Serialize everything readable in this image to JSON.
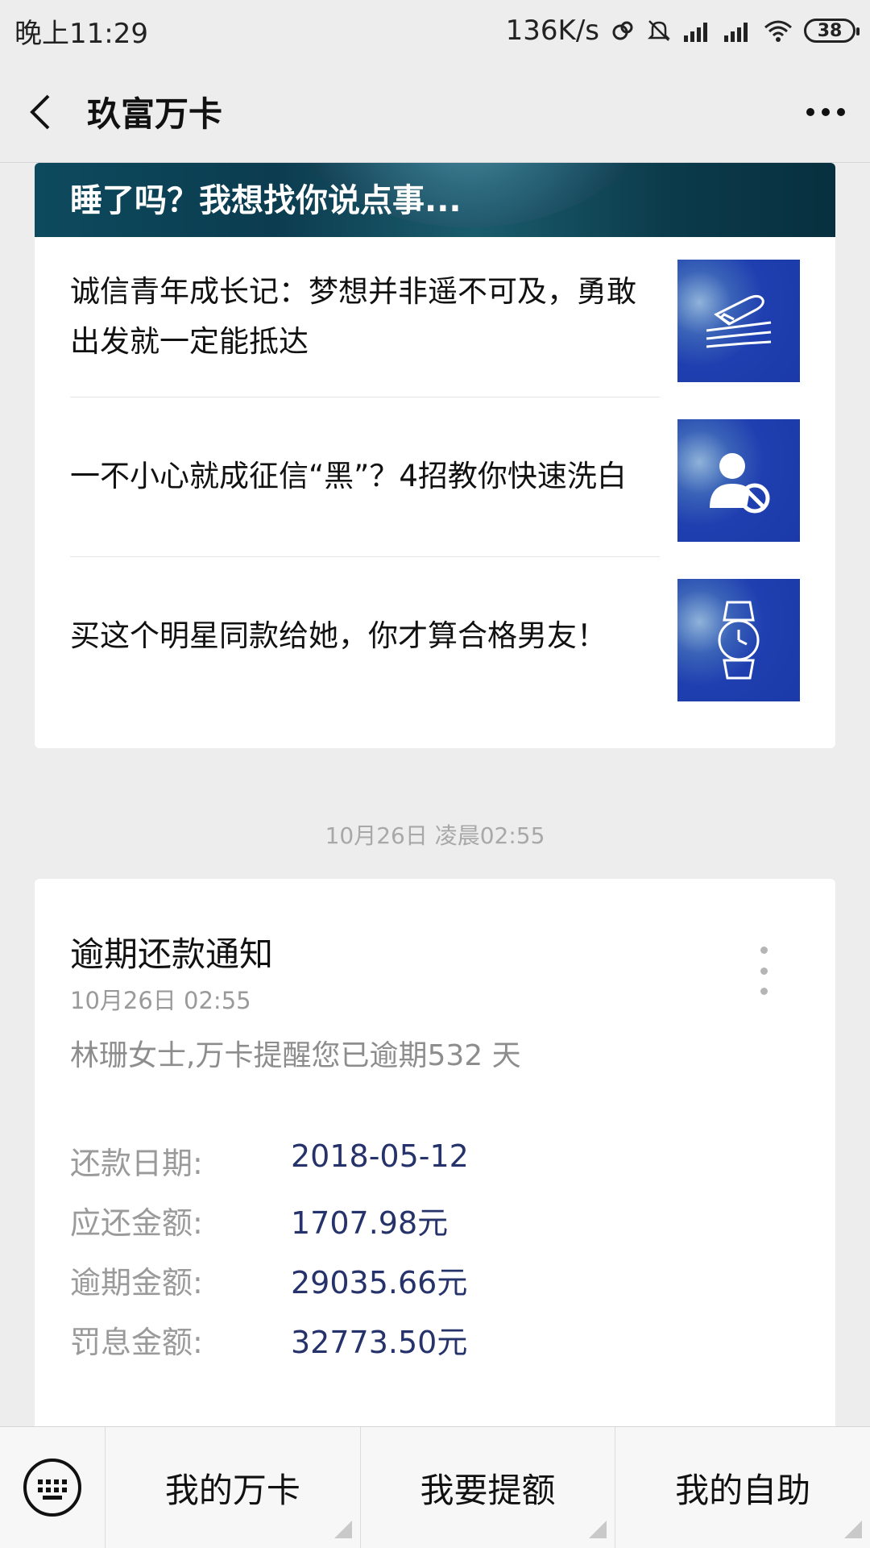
{
  "status_bar": {
    "time": "晚上11:29",
    "net_speed": "136K/s",
    "battery": "38"
  },
  "nav": {
    "title": "玖富万卡"
  },
  "banner": {
    "title": "睡了吗？我想找你说点事..."
  },
  "articles": [
    {
      "title": "诚信青年成长记：梦想并非遥不可及，勇敢出发就一定能抵达",
      "icon": "airplane-icon"
    },
    {
      "title": "一不小心就成征信“黑”？4招教你快速洗白",
      "icon": "user-blocked-icon"
    },
    {
      "title": "买这个明星同款给她，你才算合格男友！",
      "icon": "watch-icon"
    }
  ],
  "timestamp": "10月26日 凌晨02:55",
  "notice": {
    "title": "逾期还款通知",
    "date": "10月26日  02:55",
    "message": "林珊女士,万卡提醒您已逾期532 天",
    "fields": [
      {
        "label": "还款日期:",
        "value": "2018-05-12"
      },
      {
        "label": "应还金额:",
        "value": "1707.98元"
      },
      {
        "label": "逾期金额:",
        "value": "29035.66元"
      },
      {
        "label": "罚息金额:",
        "value": "32773.50元"
      }
    ]
  },
  "bottom_menu": {
    "items": [
      "我的万卡",
      "我要提额",
      "我的自助"
    ]
  },
  "colors": {
    "value_text": "#26336b",
    "thumb_blue": "#1f3fb0"
  }
}
